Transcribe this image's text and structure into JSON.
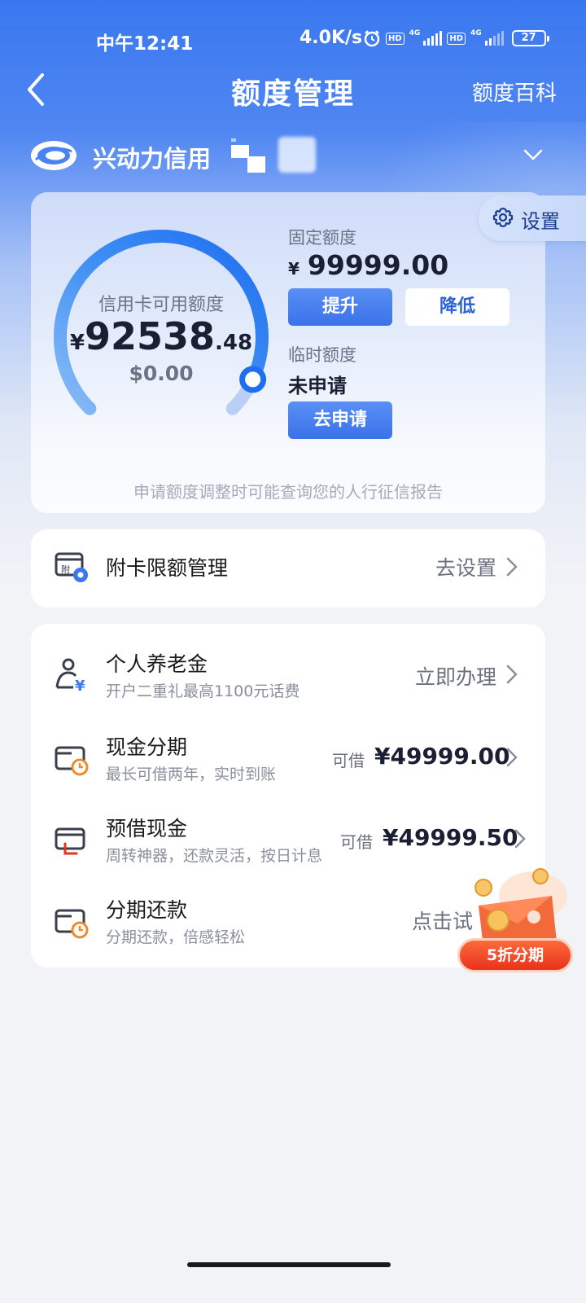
{
  "status_bar": {
    "time": "中午12:41",
    "speed": "4.0K/s",
    "network_1": "4G",
    "network_2": "4G",
    "battery": "27",
    "hd_label": "HD"
  },
  "nav": {
    "title": "额度管理",
    "right_link": "额度百科"
  },
  "card_selector": {
    "name": "兴动力信用"
  },
  "settings": {
    "label": "设置"
  },
  "limits": {
    "gauge_label": "信用卡可用额度",
    "available_currency": "¥",
    "available_integer": "92538",
    "available_decimal": ".48",
    "available_usd": "$0.00",
    "available_fraction": 0.925,
    "fixed_label": "固定额度",
    "fixed_currency": "¥",
    "fixed_amount": "99999.00",
    "raise_button": "提升",
    "lower_button": "降低",
    "temp_label": "临时额度",
    "temp_status": "未申请",
    "apply_button": "去申请",
    "notice": "申请额度调整时可能查询您的人行征信报告"
  },
  "supplementary": {
    "title": "附卡限额管理",
    "action": "去设置",
    "icon_text": "附"
  },
  "services": [
    {
      "title": "个人养老金",
      "subtitle": "开户二重礼最高1100元话费",
      "action": "立即办理"
    },
    {
      "title": "现金分期",
      "subtitle": "最长可借两年，实时到账",
      "prefix": "可借",
      "amount": "¥49999.00"
    },
    {
      "title": "预借现金",
      "subtitle": "周转神器，还款灵活，按日计息",
      "prefix": "可借",
      "amount": "¥49999.50"
    },
    {
      "title": "分期还款",
      "subtitle": "分期还款，倍感轻松",
      "action": "点击试"
    }
  ],
  "promo": {
    "label": "5折分期"
  },
  "colors": {
    "primary": "#3a72ea",
    "header_blue": "#3a78f0",
    "gauge_dot": "#1f6ef0"
  }
}
